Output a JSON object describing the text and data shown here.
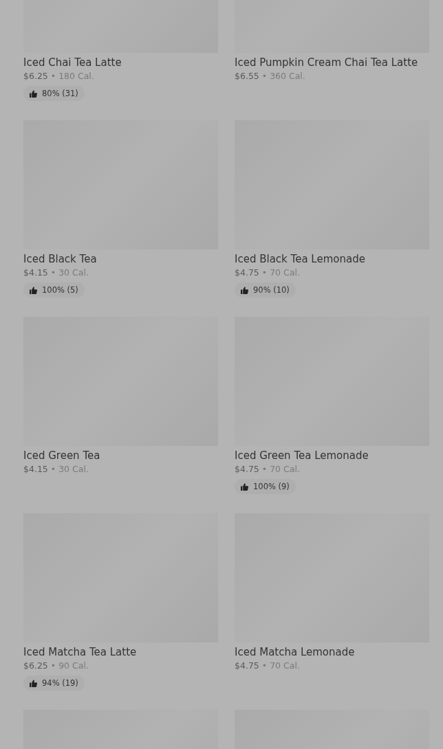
{
  "items": [
    {
      "kind": "product",
      "name": "Iced Chai Tea Latte",
      "price": "$6.25",
      "separator": "•",
      "calories": "180 Cal.",
      "rating": "80% (31)"
    },
    {
      "kind": "product",
      "name": "Iced Pumpkin Cream Chai Tea Latte",
      "price": "$6.55",
      "separator": "•",
      "calories": "360 Cal."
    },
    {
      "kind": "product",
      "name": "Iced Black Tea",
      "price": "$4.15",
      "separator": "•",
      "calories": "30 Cal.",
      "rating": "100% (5)"
    },
    {
      "kind": "product",
      "name": "Iced Black Tea Lemonade",
      "price": "$4.75",
      "separator": "•",
      "calories": "70 Cal.",
      "rating": "90% (10)"
    },
    {
      "kind": "product",
      "name": "Iced Green Tea",
      "price": "$4.15",
      "separator": "•",
      "calories": "30 Cal."
    },
    {
      "kind": "product",
      "name": "Iced Green Tea Lemonade",
      "price": "$4.75",
      "separator": "•",
      "calories": "70 Cal.",
      "rating": "100% (9)"
    },
    {
      "kind": "product",
      "name": "Iced Matcha Tea Latte",
      "price": "$6.25",
      "separator": "•",
      "calories": "90 Cal.",
      "rating": "94% (19)"
    },
    {
      "kind": "product",
      "name": "Iced Matcha Lemonade",
      "price": "$4.75",
      "separator": "•",
      "calories": "70 Cal."
    },
    {
      "kind": "image-only"
    },
    {
      "kind": "image-only"
    }
  ]
}
